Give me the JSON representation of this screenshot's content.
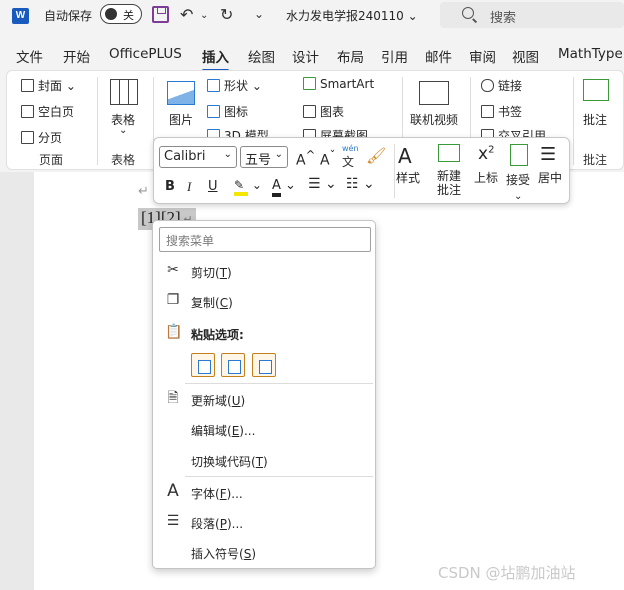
{
  "titlebar": {
    "autosave_label": "自动保存",
    "autosave_state": "关",
    "document_title": "水力发电学报240110",
    "search_placeholder": "搜索"
  },
  "tabs": [
    "文件",
    "开始",
    "OfficePLUS",
    "插入",
    "绘图",
    "设计",
    "布局",
    "引用",
    "邮件",
    "审阅",
    "视图",
    "MathType"
  ],
  "active_tab": "插入",
  "ribbon": {
    "pages_group": {
      "items": [
        "封面",
        "空白页",
        "分页"
      ],
      "label": "页面"
    },
    "table_group": {
      "button": "表格",
      "label": "表格"
    },
    "illustrations_group": {
      "picture": "图片",
      "shapes": "形状",
      "icons": "图标",
      "model3d": "3D 模型",
      "smartart": "SmartArt",
      "chart": "图表",
      "screenshot": "屏幕截图"
    },
    "media_group": {
      "online_video": "联机视频"
    },
    "links_group": {
      "link": "链接",
      "bookmark": "书签",
      "cross_ref": "交叉引用"
    },
    "comments_group": {
      "comment": "批注",
      "label": "批注"
    }
  },
  "document": {
    "selected_text": "[1][2]"
  },
  "mini_toolbar": {
    "font_name": "Calibri",
    "font_size": "五号",
    "styles": "样式",
    "new_comment_line1": "新建",
    "new_comment_line2": "批注",
    "superscript": "上标",
    "accept": "接受",
    "center": "居中",
    "bold": "B",
    "italic": "I",
    "underline": "U",
    "wen": "wén",
    "wen_char": "文"
  },
  "context_menu": {
    "search_placeholder": "搜索菜单",
    "cut": "剪切",
    "cut_key": "T",
    "copy": "复制",
    "copy_key": "C",
    "paste_options": "粘贴选项:",
    "update_field": "更新域",
    "update_field_key": "U",
    "edit_field": "编辑域",
    "edit_field_key": "E",
    "toggle_codes": "切换域代码",
    "toggle_codes_key": "T",
    "font": "字体",
    "font_key": "F",
    "paragraph": "段落",
    "paragraph_key": "P",
    "insert_symbol": "插入符号",
    "insert_symbol_key": "S"
  },
  "watermark": "CSDN @坫鹏加油站",
  "colors": {
    "accent": "#185abd",
    "selection": "#c8c8c8"
  }
}
